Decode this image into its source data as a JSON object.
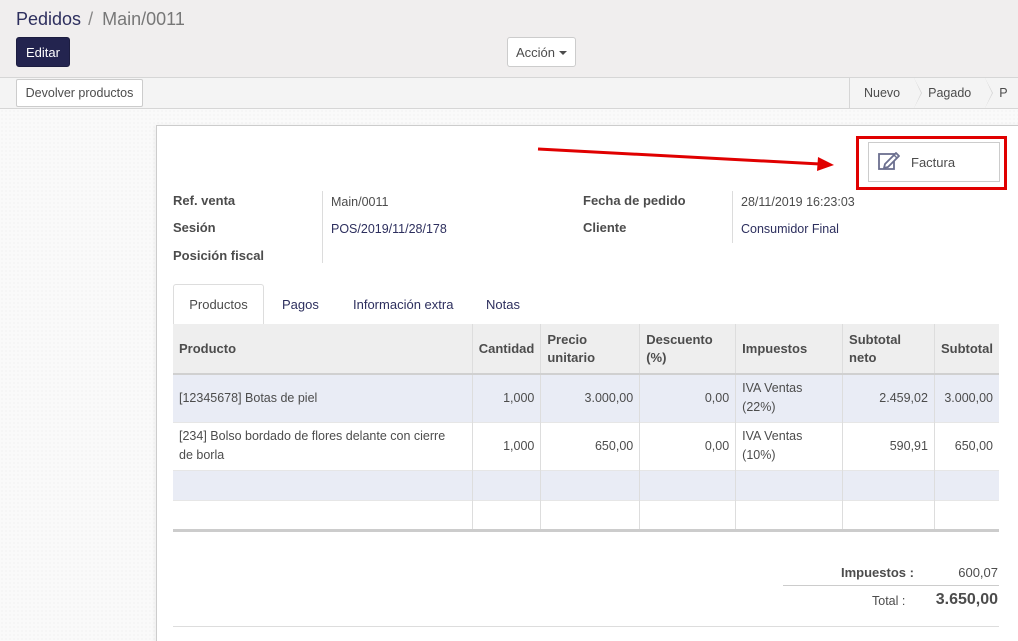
{
  "breadcrumb": {
    "parent": "Pedidos",
    "separator": "/",
    "current": "Main/0011"
  },
  "buttons": {
    "edit": "Editar",
    "action": "Acción"
  },
  "statusbar": {
    "return_products": "Devolver productos",
    "steps": [
      "Nuevo",
      "Pagado",
      "P"
    ]
  },
  "invoice_button": {
    "label": "Factura",
    "icon": "edit-icon"
  },
  "fields": {
    "ref_venta_label": "Ref. venta",
    "ref_venta_value": "Main/0011",
    "sesion_label": "Sesión",
    "sesion_value": "POS/2019/11/28/178",
    "posicion_fiscal_label": "Posición fiscal",
    "fecha_label": "Fecha de pedido",
    "fecha_value": "28/11/2019 16:23:03",
    "cliente_label": "Cliente",
    "cliente_value": "Consumidor Final"
  },
  "tabs": [
    "Productos",
    "Pagos",
    "Información extra",
    "Notas"
  ],
  "table": {
    "headers": {
      "producto": "Producto",
      "cantidad": "Cantidad",
      "precio_1": "Precio",
      "precio_2": "unitario",
      "descuento_1": "Descuento",
      "descuento_2": "(%)",
      "impuestos": "Impuestos",
      "subtotal_neto_1": "Subtotal",
      "subtotal_neto_2": "neto",
      "subtotal": "Subtotal"
    },
    "rows": [
      {
        "producto": "[12345678] Botas de piel",
        "cantidad": "1,000",
        "precio": "3.000,00",
        "descuento": "0,00",
        "impuestos_1": "IVA Ventas",
        "impuestos_2": "(22%)",
        "subtotal_neto": "2.459,02",
        "subtotal": "3.000,00"
      },
      {
        "producto_1": "[234] Bolso bordado de flores delante con cierre",
        "producto_2": "de borla",
        "cantidad": "1,000",
        "precio": "650,00",
        "descuento": "0,00",
        "impuestos_1": "IVA Ventas",
        "impuestos_2": "(10%)",
        "subtotal_neto": "590,91",
        "subtotal": "650,00"
      }
    ]
  },
  "totals": {
    "impuestos_label": "Impuestos :",
    "impuestos_value": "600,07",
    "total_label": "Total :",
    "total_value": "3.650,00"
  },
  "colors": {
    "primary": "#23244f",
    "link": "#2d2f5e",
    "highlight": "#e00000"
  }
}
